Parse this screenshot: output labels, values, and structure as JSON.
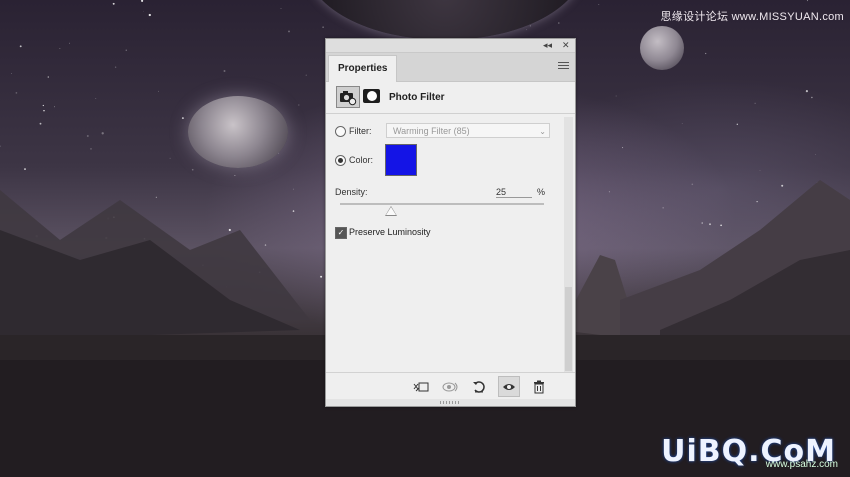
{
  "panel": {
    "tab_label": "Properties",
    "collapse_glyph": "◂◂",
    "close_glyph": "✕",
    "adjustment_title": "Photo Filter",
    "filter": {
      "label": "Filter:",
      "value": "Warming Filter (85)",
      "selected": false
    },
    "color": {
      "label": "Color:",
      "selected": true,
      "value": "#1414e6"
    },
    "density": {
      "label": "Density:",
      "value": "25",
      "unit": "%",
      "fraction": 0.25
    },
    "preserve_luminosity": {
      "label": "Preserve Luminosity",
      "checked": true
    },
    "footer_icons": [
      "clip-to-layer-icon",
      "view-previous-state-icon",
      "reset-icon",
      "visibility-eye-icon",
      "trash-icon"
    ]
  },
  "watermarks": {
    "top_text": "思缘设计论坛 www.MISSYUAN.com",
    "logo_text": "UiBQ.CoM",
    "logo_sub": "www.psahz.com"
  },
  "colors": {
    "panel_bg": "#efefef",
    "swatch": "#1414e6"
  }
}
